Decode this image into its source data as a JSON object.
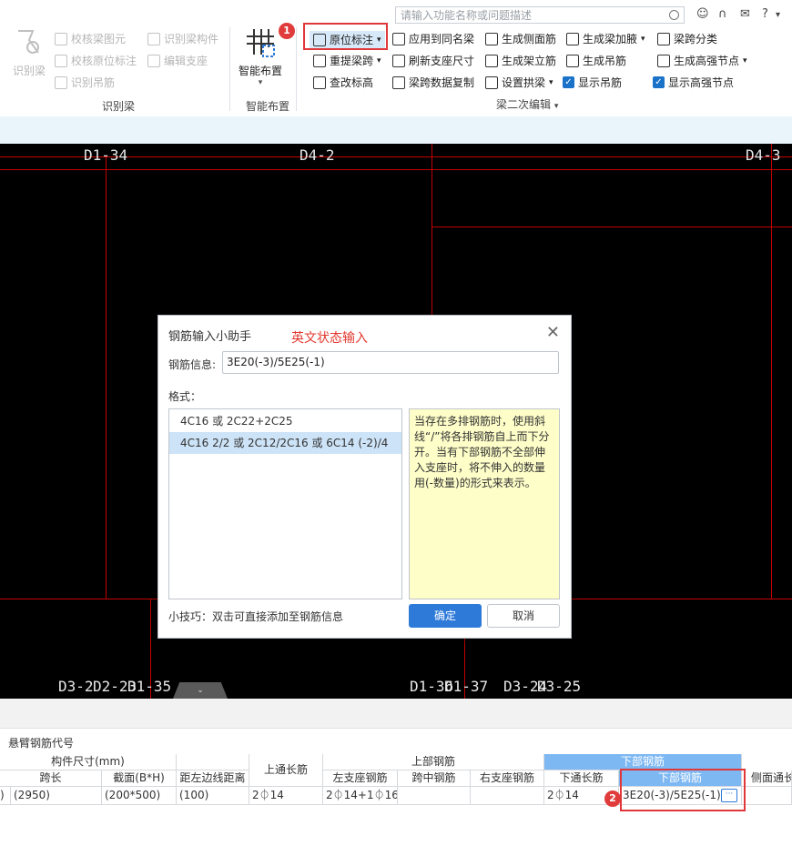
{
  "search": {
    "placeholder": "请输入功能名称或问题描述"
  },
  "top_icons": [
    "user-circle-icon",
    "headset-icon",
    "chat-icon",
    "help-icon",
    "more-icon"
  ],
  "ribbon": {
    "recognize": {
      "big_label": "识别梁",
      "items": [
        "校核梁图元",
        "校核原位标注",
        "识别吊筋",
        "识别梁构件",
        "编辑支座"
      ],
      "group": "识别梁"
    },
    "smart": {
      "big_label": "智能布置",
      "group": "智能布置"
    },
    "edit": {
      "col1": [
        "原位标注",
        "重提梁跨",
        "查改标高"
      ],
      "col2": [
        "应用到同名梁",
        "刷新支座尺寸",
        "梁跨数据复制"
      ],
      "col3": [
        "生成侧面筋",
        "生成架立筋",
        "设置拱梁"
      ],
      "col4": [
        "生成梁加腋",
        "生成吊筋",
        "显示吊筋"
      ],
      "col5": [
        "梁跨分类",
        "生成高强节点",
        "显示高强节点"
      ],
      "group": "梁二次编辑"
    }
  },
  "badges": {
    "one": "1",
    "two": "2"
  },
  "canvas": {
    "labels": [
      "D1-34",
      "D4-2",
      "D4-3",
      "D3-2",
      "D2-23",
      "D1-35",
      "D1-36",
      "D1-37",
      "D3-24",
      "D3-25"
    ]
  },
  "dialog": {
    "title": "钢筋输入小助手",
    "hint": "英文状态输入",
    "rebar_label": "钢筋信息:",
    "rebar_value": "3E20(-3)/5E25(-1)",
    "format_label": "格式：",
    "formats": [
      "4C16 或 2C22+2C25",
      "4C16 2/2 或 2C12/2C16 或 6C14 (-2)/4"
    ],
    "description": "当存在多排钢筋时，使用斜线“/”将各排钢筋自上而下分开。当有下部钢筋不全部伸入支座时，将不伸入的数量用(-数量)的形式来表示。",
    "tip": "小技巧：双击可直接添加至钢筋信息",
    "ok": "确定",
    "cancel": "取消"
  },
  "table": {
    "section_label": "悬臂钢筋代号",
    "group_headers": {
      "size": "构件尺寸(mm)",
      "top_long": "上通长筋",
      "top": "上部钢筋",
      "bottom": "下部钢筋"
    },
    "headers": [
      "跨长",
      "截面(B*H)",
      "距左边线距离",
      "左支座钢筋",
      "跨中钢筋",
      "右支座钢筋",
      "下通长筋",
      "下部钢筋",
      "侧面通长"
    ],
    "row": {
      "lead": ")",
      "span": "(2950)",
      "section": "(200*500)",
      "offset": "(100)",
      "top_long": "2⏀14",
      "left_support": "2⏀14+1⏀16",
      "mid": "",
      "right_support": "",
      "bottom_long": "2⏀14",
      "bottom": "3E20(-3)/5E25(-1)"
    }
  },
  "colors": {
    "accent": "#2e7ad9",
    "highlight": "#e0383a",
    "canvas_line": "#c40000"
  }
}
